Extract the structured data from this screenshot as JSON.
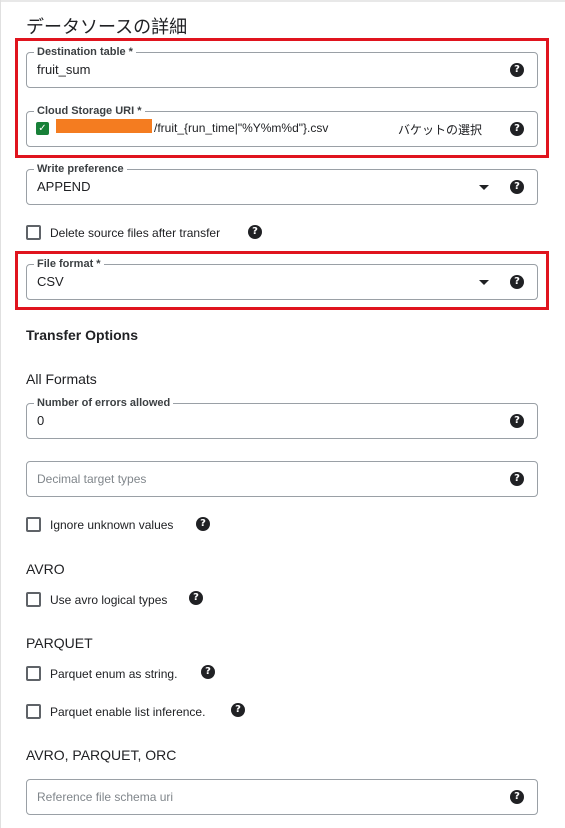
{
  "page": {
    "heading": "データソースの詳細"
  },
  "destination_table": {
    "label": "Destination table *",
    "value": "fruit_sum"
  },
  "cloud_storage_uri": {
    "label": "Cloud Storage URI *",
    "value_suffix": "/fruit_{run_time|\"%Y%m%d\"}.csv",
    "bucket_button": "バケットの選択"
  },
  "write_preference": {
    "label": "Write preference",
    "value": "APPEND"
  },
  "delete_source": {
    "label": "Delete source files after transfer",
    "checked": false
  },
  "file_format": {
    "label": "File format *",
    "value": "CSV"
  },
  "transfer_options": {
    "title": "Transfer Options",
    "all_formats_title": "All Formats",
    "errors_allowed": {
      "label": "Number of errors allowed",
      "value": "0"
    },
    "decimal_target_types": {
      "placeholder": "Decimal target types"
    },
    "ignore_unknown": {
      "label": "Ignore unknown values",
      "checked": false
    },
    "avro_title": "AVRO",
    "avro_logical": {
      "label": "Use avro logical types",
      "checked": false
    },
    "parquet_title": "PARQUET",
    "parquet_enum": {
      "label": "Parquet enum as string.",
      "checked": false
    },
    "parquet_list": {
      "label": "Parquet enable list inference.",
      "checked": false
    },
    "apo_title": "AVRO, PARQUET, ORC",
    "reference_schema": {
      "placeholder": "Reference file schema uri"
    }
  },
  "help_glyph": "?",
  "check_glyph": "✓",
  "colors": {
    "highlight": "#e0141e",
    "redaction": "#f47c20",
    "checkbox_checked": "#188038"
  }
}
